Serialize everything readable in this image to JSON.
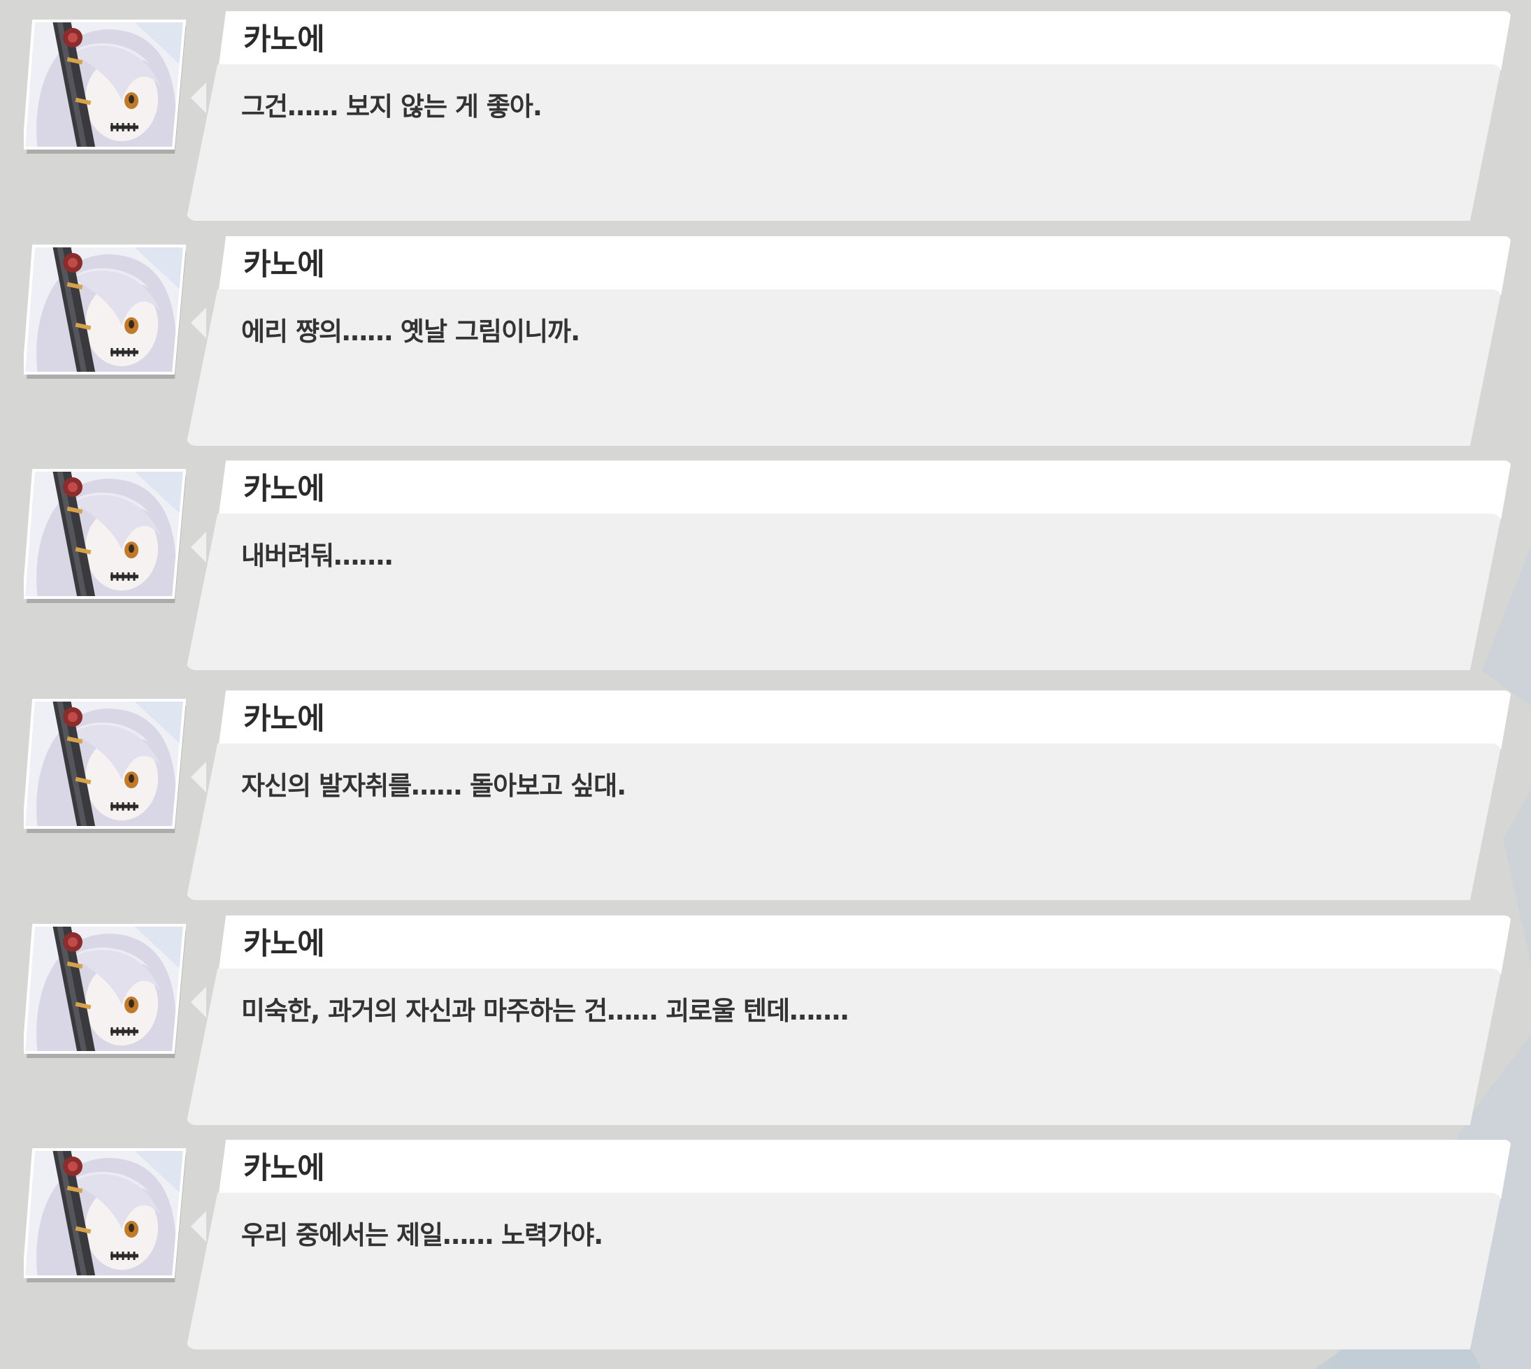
{
  "colors": {
    "background": "#d6d6d4",
    "name_plate": "#ffffff",
    "dialog_box": "#f0f0f0",
    "name_text": "#2a2a2a",
    "dialog_text": "#333333",
    "portrait_hair": "#d9d6e6",
    "portrait_eye": "#c07a2a"
  },
  "portrait": {
    "icon": "kanoe-portrait-icon"
  },
  "entries": [
    {
      "speaker": "카노에",
      "text": "그건…… 보지 않는 게 좋아."
    },
    {
      "speaker": "카노에",
      "text": "에리 쨩의…… 옛날 그림이니까."
    },
    {
      "speaker": "카노에",
      "text": "내버려둬……."
    },
    {
      "speaker": "카노에",
      "text": "자신의 발자취를…… 돌아보고 싶대."
    },
    {
      "speaker": "카노에",
      "text": "미숙한, 과거의 자신과 마주하는 건…… 괴로울 텐데……."
    },
    {
      "speaker": "카노에",
      "text": "우리 중에서는 제일…… 노력가야."
    }
  ]
}
